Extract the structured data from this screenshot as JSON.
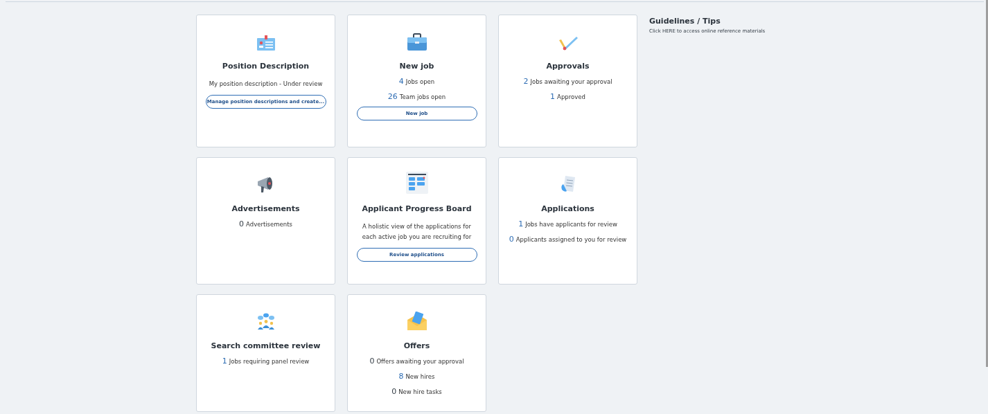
{
  "cards": [
    {
      "title": "Position Description",
      "items": [
        {
          "kind": "text",
          "text": "My position description - Under review"
        },
        {
          "kind": "button",
          "text": "Manage position descriptions and create..."
        }
      ]
    },
    {
      "title": "New job",
      "items": [
        {
          "kind": "stat",
          "count": "4",
          "label": "Jobs open",
          "active": true
        },
        {
          "kind": "stat",
          "count": "26",
          "label": "Team jobs open",
          "active": true
        },
        {
          "kind": "button",
          "text": "New job"
        }
      ]
    },
    {
      "title": "Approvals",
      "items": [
        {
          "kind": "stat",
          "count": "2",
          "label": "Jobs awaiting your approval",
          "active": true
        },
        {
          "kind": "stat",
          "count": "1",
          "label": "Approved",
          "active": true
        }
      ]
    },
    {
      "title": "Advertisements",
      "items": [
        {
          "kind": "stat",
          "count": "0",
          "label": "Advertisements",
          "active": false
        }
      ]
    },
    {
      "title": "Applicant Progress Board",
      "items": [
        {
          "kind": "text",
          "text": "A holistic view of the applications for each active job you are recruiting for"
        },
        {
          "kind": "button",
          "text": "Review applications"
        }
      ]
    },
    {
      "title": "Applications",
      "items": [
        {
          "kind": "stat",
          "count": "1",
          "label": "Jobs have applicants for review",
          "active": true
        },
        {
          "kind": "stat",
          "count": "0",
          "label": "Applicants assigned to you for review",
          "active": true
        }
      ]
    },
    {
      "title": "Search committee review",
      "items": [
        {
          "kind": "stat",
          "count": "1",
          "label": "Jobs requiring panel review",
          "active": true
        }
      ]
    },
    {
      "title": "Offers",
      "items": [
        {
          "kind": "stat",
          "count": "0",
          "label": "Offers awaiting your approval",
          "active": false
        },
        {
          "kind": "stat",
          "count": "8",
          "label": "New hires",
          "active": true
        },
        {
          "kind": "stat",
          "count": "0",
          "label": "New hire tasks",
          "active": false
        }
      ]
    }
  ],
  "guidelines": {
    "title": "Guidelines / Tips",
    "link": "Click HERE to access online reference materials"
  }
}
